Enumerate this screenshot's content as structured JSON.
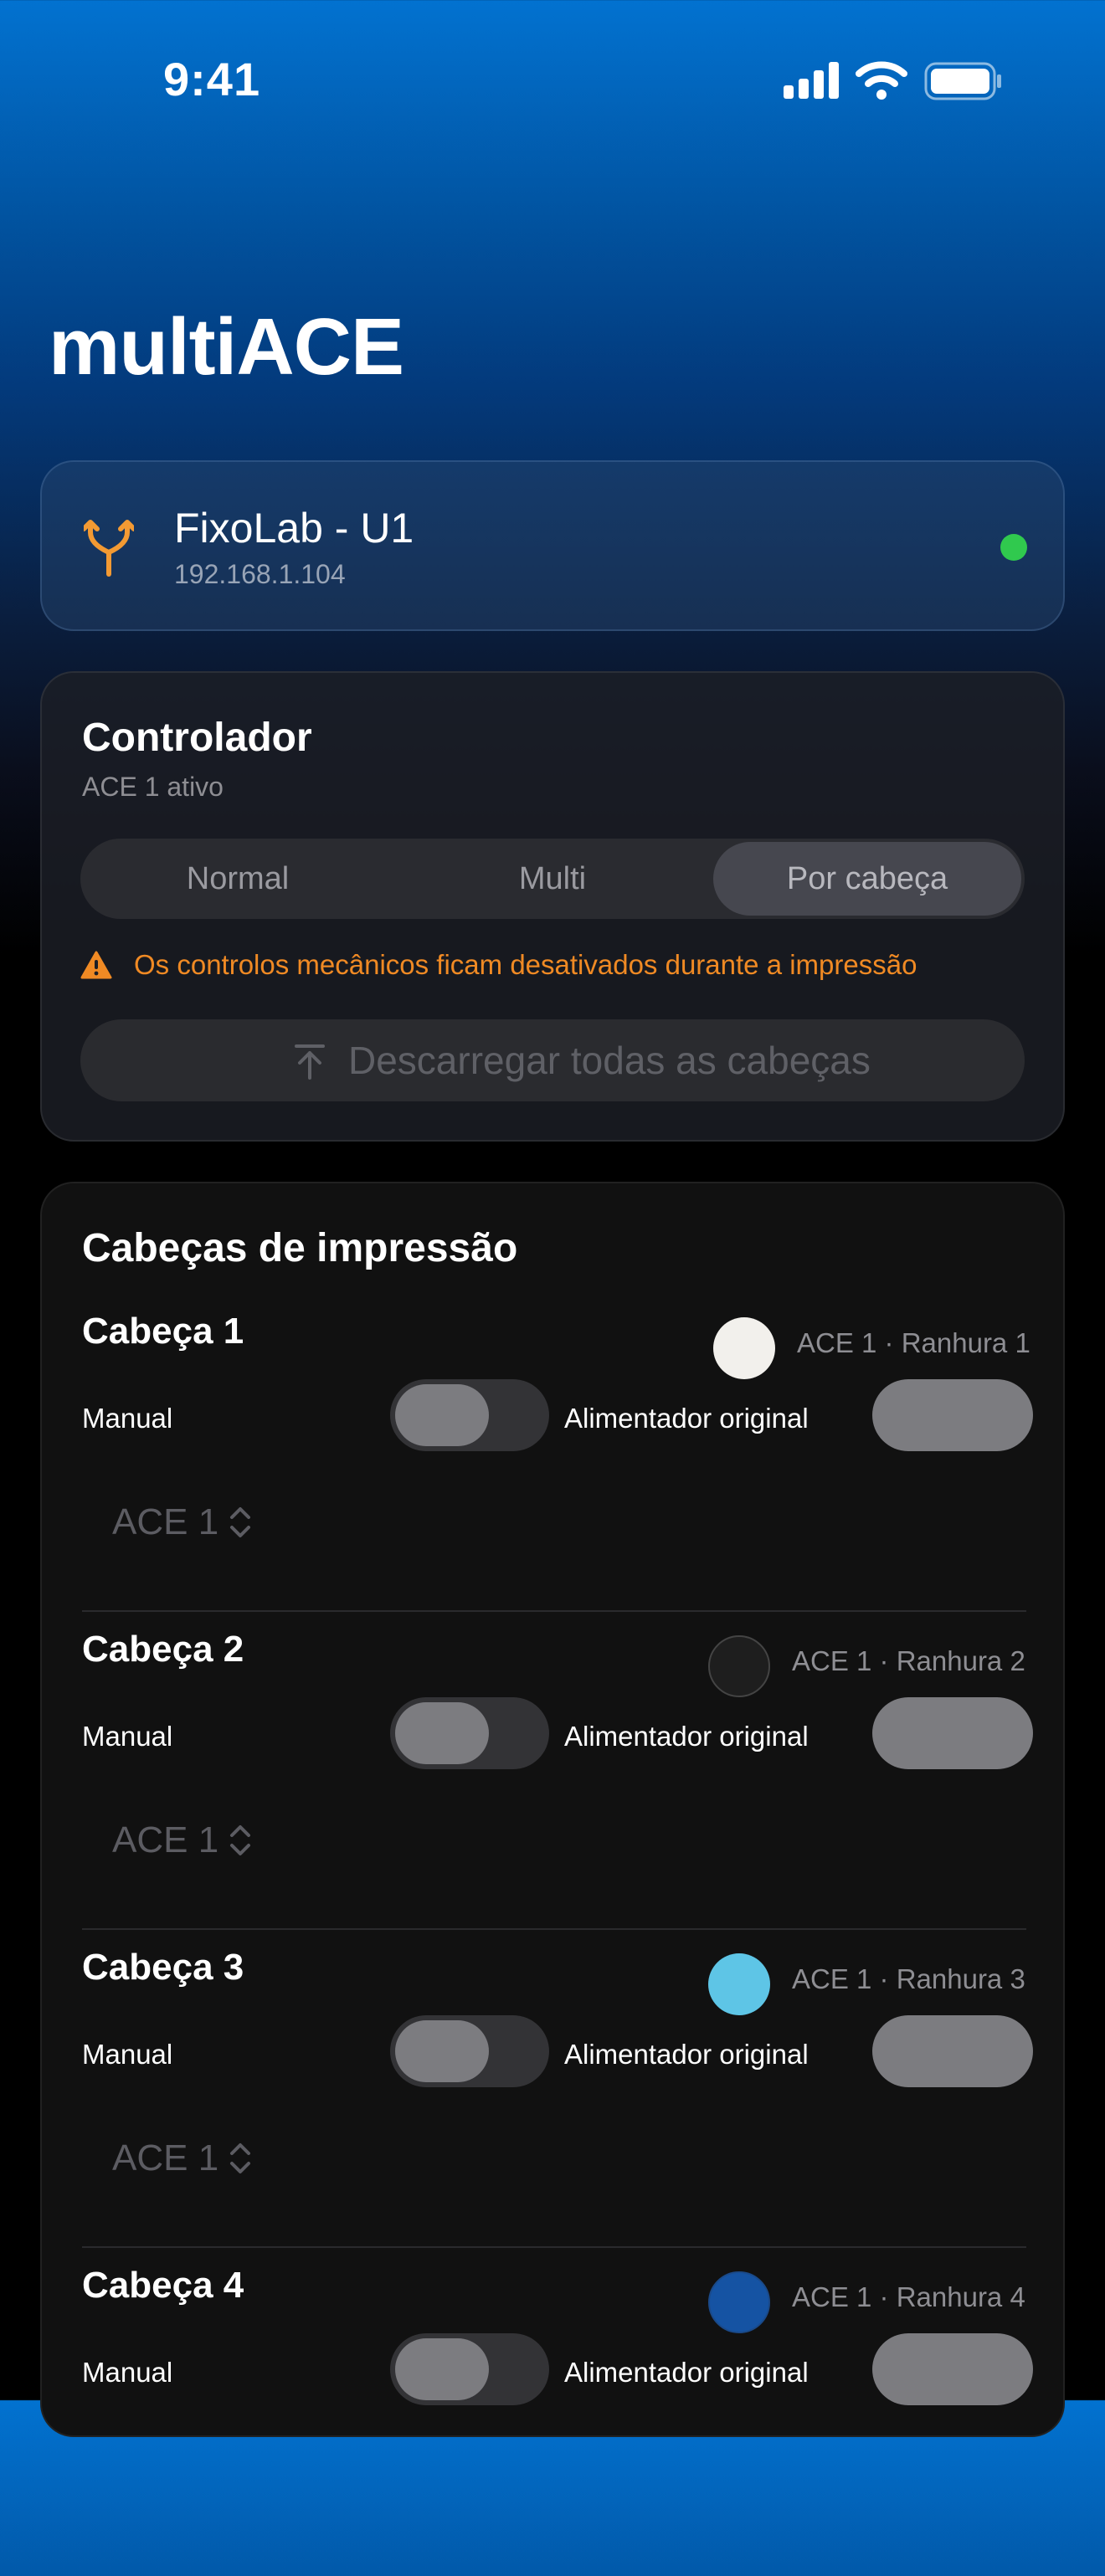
{
  "status_bar": {
    "time": "9:41",
    "icons": [
      "signal-icon",
      "wifi-icon",
      "battery-icon"
    ]
  },
  "app_title": "multiACE",
  "printer": {
    "name": "FixoLab - U1",
    "ip": "192.168.1.104",
    "status_color": "#30c94e",
    "icon": "fork-icon"
  },
  "controller": {
    "title": "Controlador",
    "subtitle": "ACE 1 ativo",
    "modes": [
      "Normal",
      "Multi",
      "Por cabeça"
    ],
    "selected_mode": "Por cabeça",
    "warning": "Os controlos mecânicos ficam desativados durante a impressão",
    "unload_label": "Descarregar todas as cabeças"
  },
  "heads_section": {
    "title": "Cabeças de impressão",
    "manual_label": "Manual",
    "feeder_label": "Alimentador original",
    "heads": [
      {
        "name": "Cabeça 1",
        "slot": "ACE 1 · Ranhura 1",
        "color": "#f2f0ec",
        "selector": "ACE 1",
        "manual_on": false,
        "feeder_on": false
      },
      {
        "name": "Cabeça 2",
        "slot": "ACE 1 · Ranhura 2",
        "color": "#1e1e1e",
        "selector": "ACE 1",
        "manual_on": false,
        "feeder_on": false
      },
      {
        "name": "Cabeça 3",
        "slot": "ACE 1 · Ranhura 3",
        "color": "#5ec5e6",
        "selector": "ACE 1",
        "manual_on": false,
        "feeder_on": false
      },
      {
        "name": "Cabeça 4",
        "slot": "ACE 1 · Ranhura 4",
        "color": "#1553a3",
        "selector": "ACE 1",
        "manual_on": false,
        "feeder_on": false
      }
    ]
  }
}
